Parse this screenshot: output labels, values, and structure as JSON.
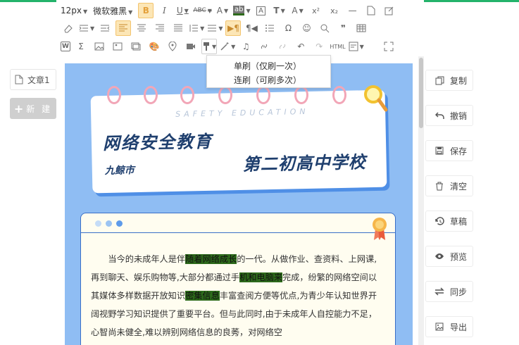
{
  "left_panel": {
    "doc_tab_label": "文章1",
    "new_button_label": "新 建"
  },
  "toolbar": {
    "font_size": "12px",
    "font_family": "微软雅黑",
    "row1": [
      "bold",
      "italic",
      "underline",
      "strikethrough",
      "font-color",
      "background-color",
      "border",
      "text-style",
      "font-size-adjust",
      "superscript",
      "subscript",
      "horizontal-rule",
      "new-page",
      "edit"
    ],
    "active_buttons": [
      "bold",
      "align-left",
      "direction"
    ]
  },
  "format_brush_menu": {
    "single_label": "单刷（仅刷一次）",
    "continuous_label": "连刷（可刷多次）"
  },
  "article": {
    "subtitle_en": "SAFETY EDUCATION",
    "title": "网络安全教育",
    "city": "九鲸市",
    "school": "第二初高中学校",
    "paragraph_segments": [
      {
        "text": "当今的未成年人是伴",
        "highlight": false
      },
      {
        "text": "随着网络成长",
        "highlight": true
      },
      {
        "text": "的一代。从做作业、查资料、上网课,再到聊天、娱乐购物等,大部分都通过手",
        "highlight": false
      },
      {
        "text": "机和电脑来",
        "highlight": true
      },
      {
        "text": "完成，纷繁的网络空间以其媒体多样数据开放知识",
        "highlight": false
      },
      {
        "text": "密集信息",
        "highlight": true
      },
      {
        "text": "丰富查阅方便等优点,为青少年认知世界开阔视野学习知识提供了重要平台。但与此同时,由于未成年人自控能力不足，心智尚未健全,难以辨别网络信息的良莠，对网络空",
        "highlight": false
      }
    ]
  },
  "right_panel": {
    "buttons": [
      {
        "label": "复制",
        "icon": "copy-icon"
      },
      {
        "label": "撤销",
        "icon": "undo-icon"
      },
      {
        "label": "保存",
        "icon": "save-icon"
      },
      {
        "label": "清空",
        "icon": "trash-icon"
      },
      {
        "label": "草稿",
        "icon": "draft-icon"
      },
      {
        "label": "预览",
        "icon": "eye-icon"
      },
      {
        "label": "同步",
        "icon": "sync-icon"
      },
      {
        "label": "导出",
        "icon": "image-export-icon"
      }
    ]
  },
  "colors": {
    "accent_green": "#24b36b",
    "canvas_blue": "#8fbdf3",
    "title_navy": "#1f3f6e",
    "highlight_green": "#2d6a1b",
    "active_tool": "#fce6b6"
  }
}
